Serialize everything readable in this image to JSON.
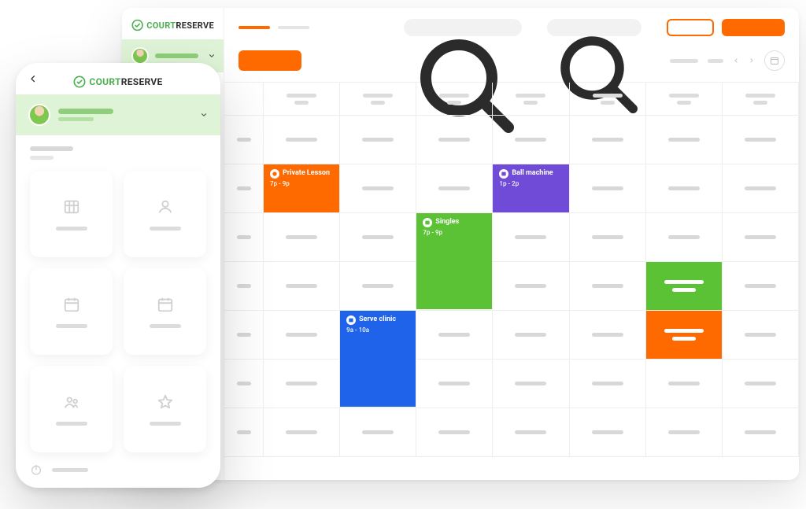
{
  "brand": {
    "court": "COURT",
    "reserve": "RESERVE"
  },
  "events": {
    "private_lesson": {
      "title": "Private Lesson",
      "time": "7p - 9p",
      "color": "#ff6a00",
      "icon": "tennis-ball-icon"
    },
    "ball_machine": {
      "title": "Ball machine",
      "time": "1p - 2p",
      "color": "#6f4bd8",
      "icon": "calendar-icon"
    },
    "singles": {
      "title": "Singles",
      "time": "7p - 9p",
      "color": "#5bc236",
      "icon": "calendar-icon"
    },
    "serve_clinic": {
      "title": "Serve clinic",
      "time": "9a - 10a",
      "color": "#1e63e9",
      "icon": "calendar-icon"
    }
  },
  "mobile_cards": [
    "grid-icon",
    "user-icon",
    "calendar-icon",
    "calendar-icon",
    "group-icon",
    "star-icon"
  ]
}
